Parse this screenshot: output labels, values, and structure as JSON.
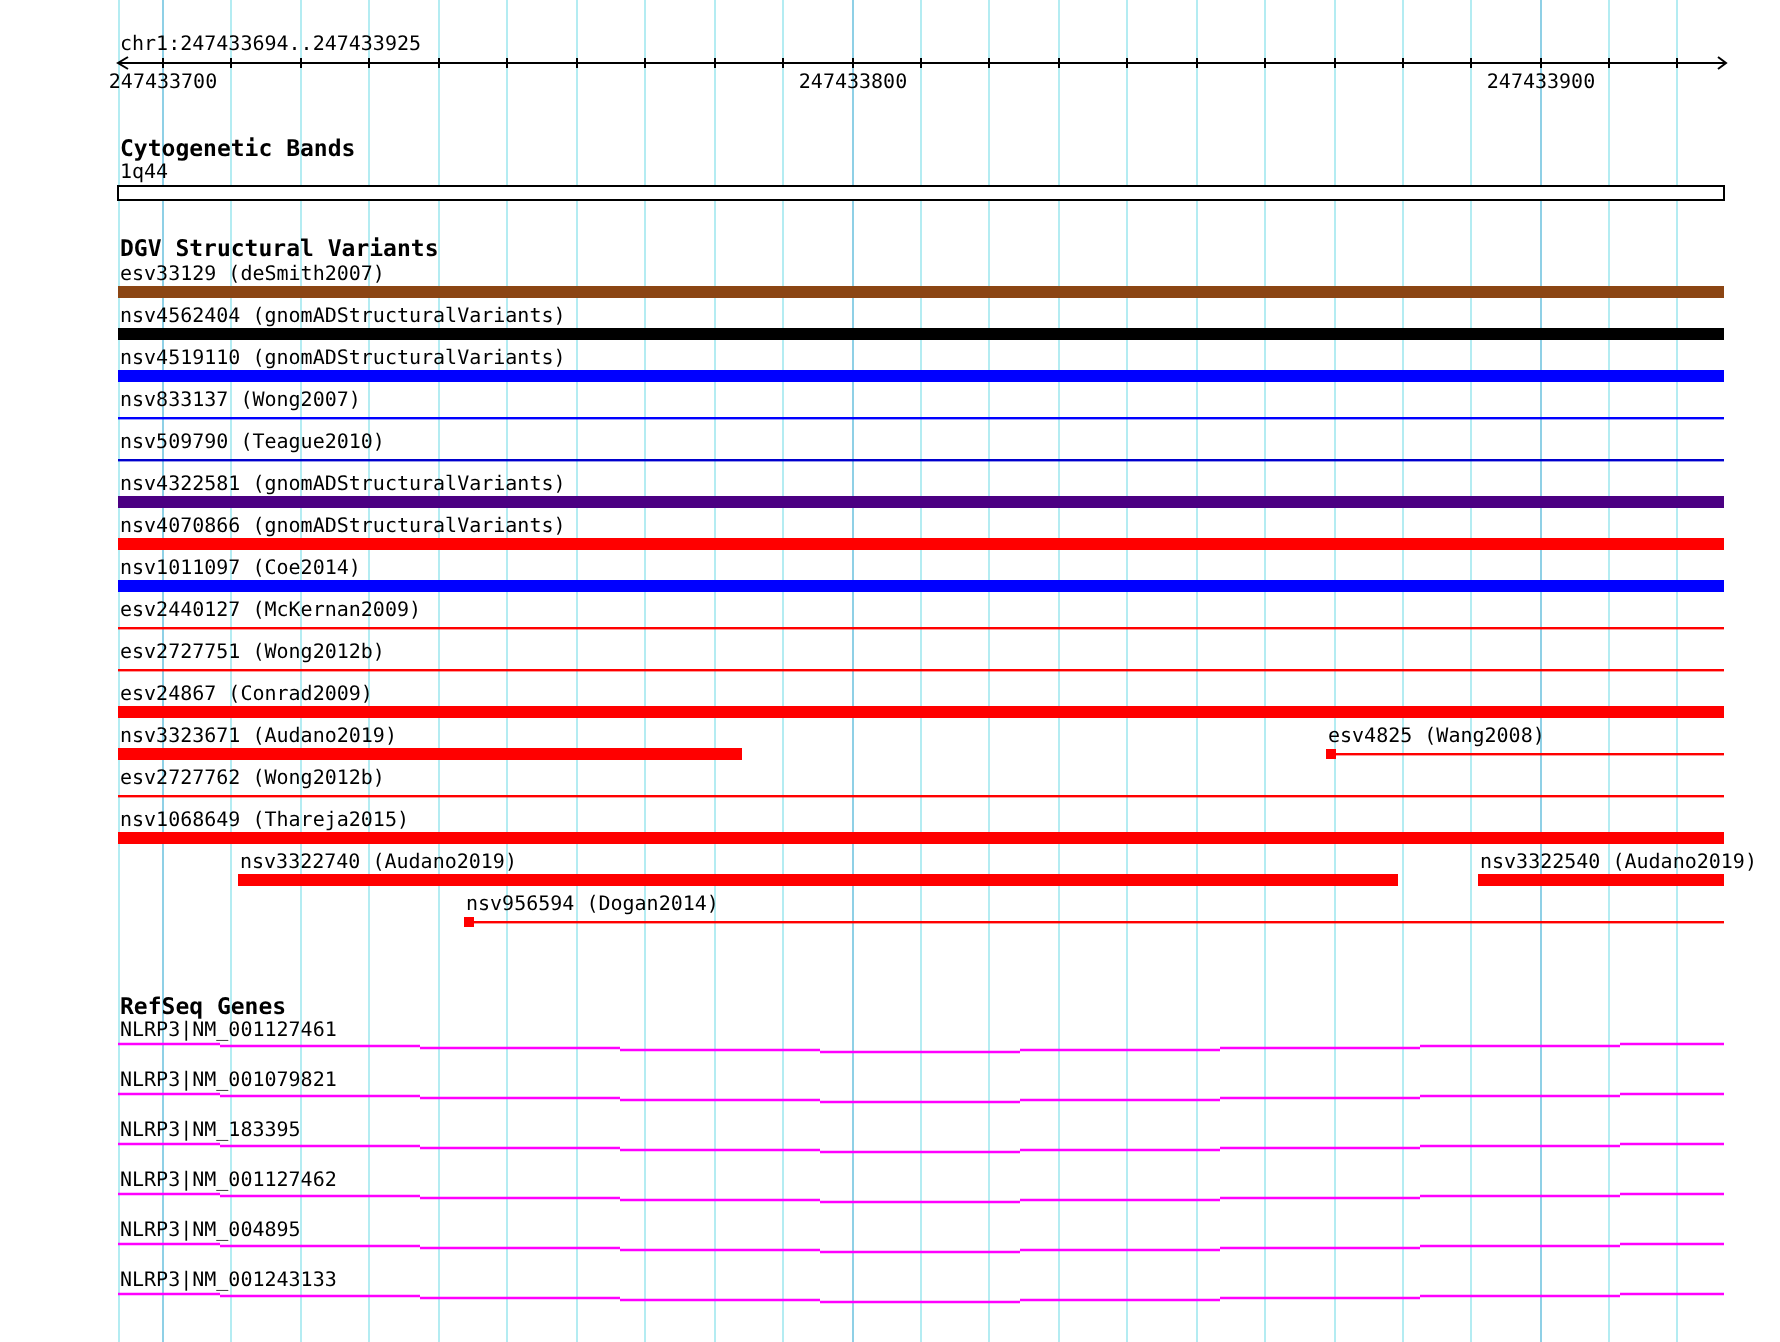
{
  "locus": "chr1:247433694..247433925",
  "ruler": {
    "ticks": [
      {
        "label": "247433700"
      },
      {
        "label": "247433800"
      },
      {
        "label": "247433900"
      }
    ]
  },
  "tracks": [
    {
      "kind": "cytoband",
      "title": "Cytogenetic Bands",
      "features": [
        {
          "name": "1q44"
        }
      ]
    },
    {
      "kind": "variants",
      "title": "DGV Structural Variants",
      "rows": [
        {
          "features": [
            {
              "name": "esv33129 (deSmith2007)",
              "kind": "thick",
              "color": "#8b4513"
            }
          ]
        },
        {
          "features": [
            {
              "name": "nsv4562404 (gnomADStructuralVariants)",
              "kind": "thick",
              "color": "#000000"
            }
          ]
        },
        {
          "features": [
            {
              "name": "nsv4519110 (gnomADStructuralVariants)",
              "kind": "thick",
              "color": "#0000ff"
            }
          ]
        },
        {
          "features": [
            {
              "name": "nsv833137 (Wong2007)",
              "kind": "thin",
              "color": "#0000ff"
            }
          ]
        },
        {
          "features": [
            {
              "name": "nsv509790 (Teague2010)",
              "kind": "thin",
              "color": "#0000cd"
            }
          ]
        },
        {
          "features": [
            {
              "name": "nsv4322581 (gnomADStructuralVariants)",
              "kind": "thick",
              "color": "#4b0082"
            }
          ]
        },
        {
          "features": [
            {
              "name": "nsv4070866 (gnomADStructuralVariants)",
              "kind": "thick",
              "color": "#ff0000"
            }
          ]
        },
        {
          "features": [
            {
              "name": "nsv1011097 (Coe2014)",
              "kind": "thick",
              "color": "#0000ff"
            }
          ]
        },
        {
          "features": [
            {
              "name": "esv2440127 (McKernan2009)",
              "kind": "thin",
              "color": "#ff0000"
            }
          ]
        },
        {
          "features": [
            {
              "name": "esv2727751 (Wong2012b)",
              "kind": "thin",
              "color": "#ff0000"
            }
          ]
        },
        {
          "features": [
            {
              "name": "esv24867 (Conrad2009)",
              "kind": "thick",
              "color": "#ff0000"
            }
          ]
        },
        {
          "features": [
            {
              "name": "nsv3323671 (Audano2019)",
              "kind": "thick",
              "color": "#ff0000"
            },
            {
              "name": "esv4825 (Wang2008)",
              "kind": "thin-block",
              "color": "#ff0000"
            }
          ]
        },
        {
          "features": [
            {
              "name": "esv2727762 (Wong2012b)",
              "kind": "thin",
              "color": "#ff0000"
            }
          ]
        },
        {
          "features": [
            {
              "name": "nsv1068649 (Thareja2015)",
              "kind": "thick",
              "color": "#ff0000"
            }
          ]
        },
        {
          "features": [
            {
              "name": "nsv3322740 (Audano2019)",
              "kind": "thick",
              "color": "#ff0000"
            },
            {
              "name": "nsv3322540 (Audano2019)",
              "kind": "thick",
              "color": "#ff0000"
            }
          ]
        },
        {
          "features": [
            {
              "name": "nsv956594 (Dogan2014)",
              "kind": "thin-block",
              "color": "#ff0000"
            }
          ]
        }
      ]
    },
    {
      "kind": "genes",
      "title": "RefSeq Genes",
      "features": [
        {
          "name": "NLRP3|NM_001127461"
        },
        {
          "name": "NLRP3|NM_001079821"
        },
        {
          "name": "NLRP3|NM_183395"
        },
        {
          "name": "NLRP3|NM_001127462"
        },
        {
          "name": "NLRP3|NM_004895"
        },
        {
          "name": "NLRP3|NM_001243133"
        }
      ]
    }
  ]
}
